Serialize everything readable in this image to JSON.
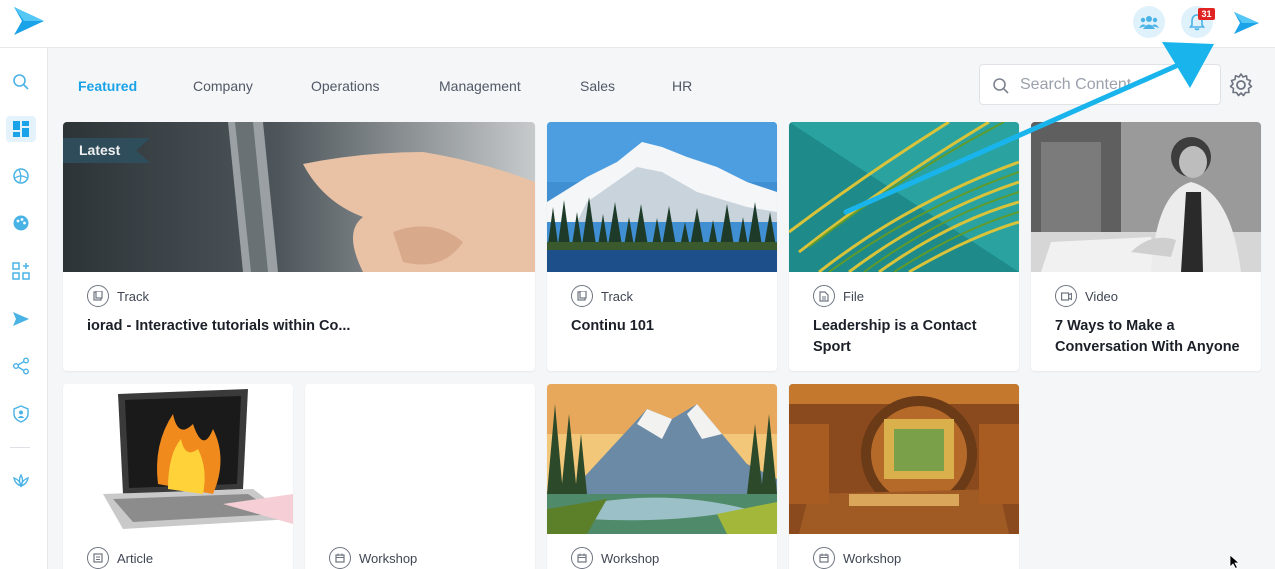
{
  "header": {
    "notifications_count": "31",
    "icons": [
      "app-logo-icon",
      "team-icon",
      "bell-icon",
      "profile-logo-icon"
    ]
  },
  "sidebar": {
    "items": [
      "search-icon",
      "dashboard-icon",
      "globe-icon",
      "palette-icon",
      "apps-add-icon",
      "send-icon",
      "share-icon",
      "shield-user-icon",
      "lotus-icon"
    ],
    "active_index": 1
  },
  "tabs": [
    {
      "label": "Featured",
      "active": true
    },
    {
      "label": "Company",
      "active": false
    },
    {
      "label": "Operations",
      "active": false
    },
    {
      "label": "Management",
      "active": false
    },
    {
      "label": "Sales",
      "active": false
    },
    {
      "label": "HR",
      "active": false
    }
  ],
  "search": {
    "placeholder": "Search Content"
  },
  "cards": [
    {
      "type": "Track",
      "title": "iorad - Interactive tutorials within Co...",
      "ribbon": "Latest"
    },
    {
      "type": "Track",
      "title": "Continu 101"
    },
    {
      "type": "File",
      "title": "Leadership is a Contact Sport"
    },
    {
      "type": "Video",
      "title": "7 Ways to Make a Conversation With Anyone"
    },
    {
      "type": "Article",
      "title": ""
    },
    {
      "type": "Workshop",
      "title": ""
    },
    {
      "type": "Workshop",
      "title": ""
    },
    {
      "type": "Workshop",
      "title": ""
    }
  ],
  "colors": {
    "accent": "#1aa3e8",
    "badge": "#e02424",
    "ribbon": "#2f4f5e",
    "annotation_arrow": "#19b4ec"
  }
}
